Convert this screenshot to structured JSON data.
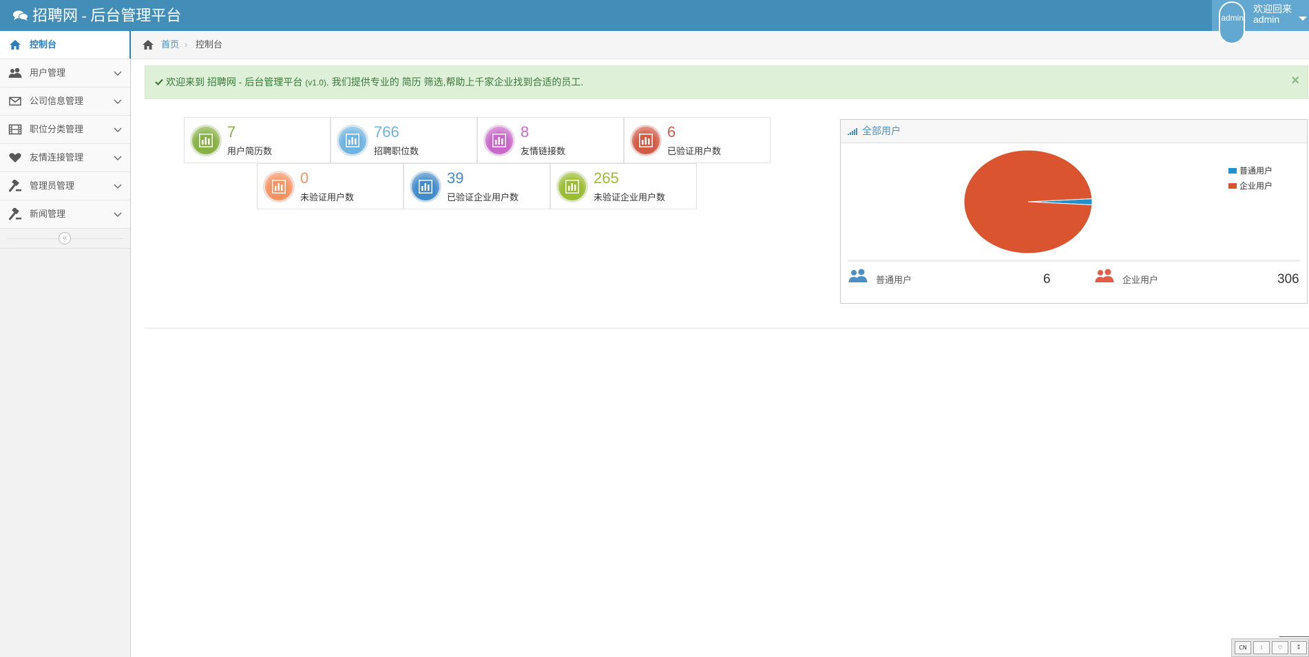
{
  "app": {
    "title": "招聘网 - 后台管理平台"
  },
  "user": {
    "avatar_alt": "admin",
    "welcome": "欢迎回来",
    "name": "admin"
  },
  "sidebar": {
    "items": [
      {
        "label": "控制台",
        "icon": "home-icon"
      },
      {
        "label": "用户管理",
        "icon": "users-icon"
      },
      {
        "label": "公司信息管理",
        "icon": "envelope-icon"
      },
      {
        "label": "职位分类管理",
        "icon": "film-icon"
      },
      {
        "label": "友情连接管理",
        "icon": "heart-icon"
      },
      {
        "label": "管理员管理",
        "icon": "gavel-icon"
      },
      {
        "label": "新闻管理",
        "icon": "gavel-icon"
      }
    ],
    "collapse_glyph": "«"
  },
  "breadcrumb": {
    "home": "首页",
    "separator": "›",
    "current": "控制台"
  },
  "alert": {
    "prefix": "欢迎来到",
    "brand": "招聘网 - 后台管理平台",
    "version": "(v1.0)",
    "middle": ". 我们提供专业的",
    "highlight": "简历",
    "suffix": "筛选,帮助上千家企业找到合适的员工.",
    "close": "×"
  },
  "stats": [
    {
      "value": "7",
      "label": "用户简历数",
      "color": "#87b144"
    },
    {
      "value": "766",
      "label": "招聘职位数",
      "color": "#6fb3e0"
    },
    {
      "value": "8",
      "label": "友情链接数",
      "color": "#c868c8"
    },
    {
      "value": "6",
      "label": "已验证用户数",
      "color": "#d15b47"
    },
    {
      "value": "0",
      "label": "未验证用户数",
      "color": "#f79263"
    },
    {
      "value": "39",
      "label": "已验证企业用户数",
      "color": "#428bca"
    },
    {
      "value": "265",
      "label": "未验证企业用户数",
      "color": "#9abc32"
    }
  ],
  "widget": {
    "title": "全部用户",
    "summary": [
      {
        "label": "普通用户",
        "value": "6",
        "color": "#4b8fc6"
      },
      {
        "label": "企业用户",
        "value": "306",
        "color": "#e25c4a"
      }
    ]
  },
  "chart_data": {
    "type": "pie",
    "categories": [
      "普通用户",
      "企业用户"
    ],
    "values": [
      6,
      306
    ],
    "colors": [
      "#2091cf",
      "#da5430"
    ],
    "legend_position": "top-right"
  },
  "ime_toolbar": {
    "buttons": [
      "CN",
      "⁝",
      "♡",
      "⁑"
    ]
  },
  "colors": {
    "navbar": "#438eb9",
    "accent": "#2b7dbc"
  }
}
